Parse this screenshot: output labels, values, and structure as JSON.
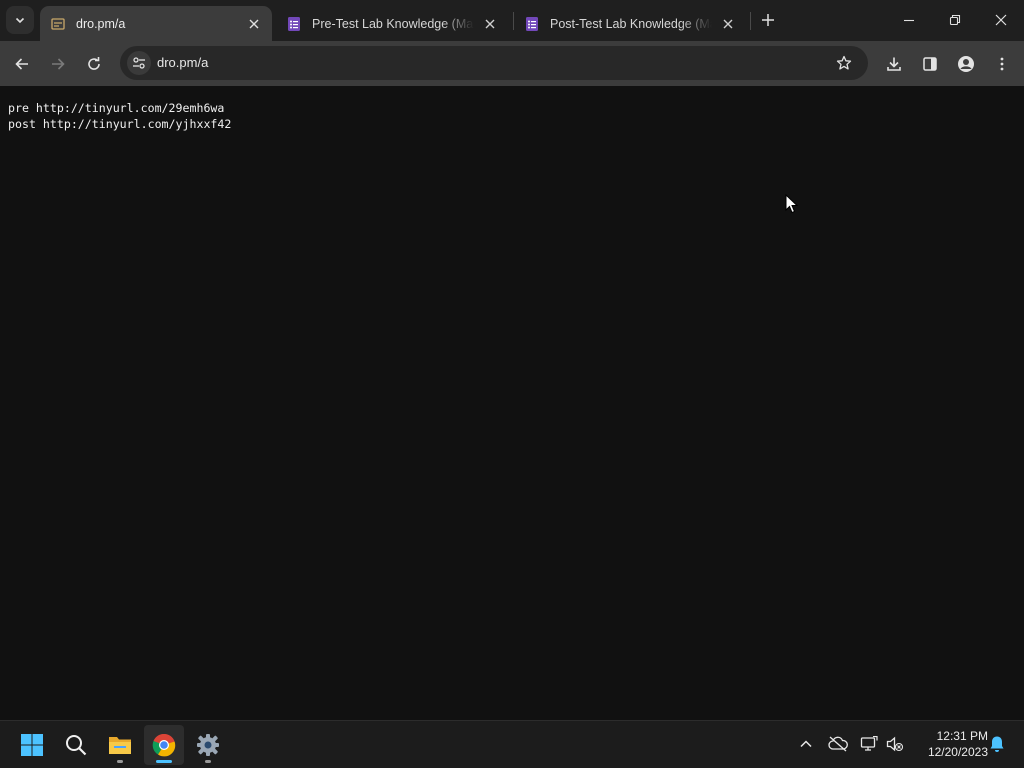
{
  "browser": {
    "tabs": [
      {
        "title": "dro.pm/a",
        "active": true,
        "favicon": "page-favicon-icon"
      },
      {
        "title": "Pre-Test Lab Knowledge (Materials Check)",
        "active": false,
        "favicon": "google-forms-icon"
      },
      {
        "title": "Post-Test Lab Knowledge (Materials Check)",
        "active": false,
        "favicon": "google-forms-icon"
      }
    ],
    "address_bar": {
      "url": "dro.pm/a"
    },
    "accent_color": "#7248b9"
  },
  "page": {
    "lines": [
      "pre http://tinyurl.com/29emh6wa",
      "post http://tinyurl.com/yjhxxf42"
    ]
  },
  "taskbar": {
    "apps": [
      "windows-start-icon",
      "search-icon",
      "file-explorer-icon",
      "chrome-icon",
      "settings-icon"
    ],
    "clock": {
      "time": "12:31 PM",
      "date": "12/20/2023"
    }
  }
}
